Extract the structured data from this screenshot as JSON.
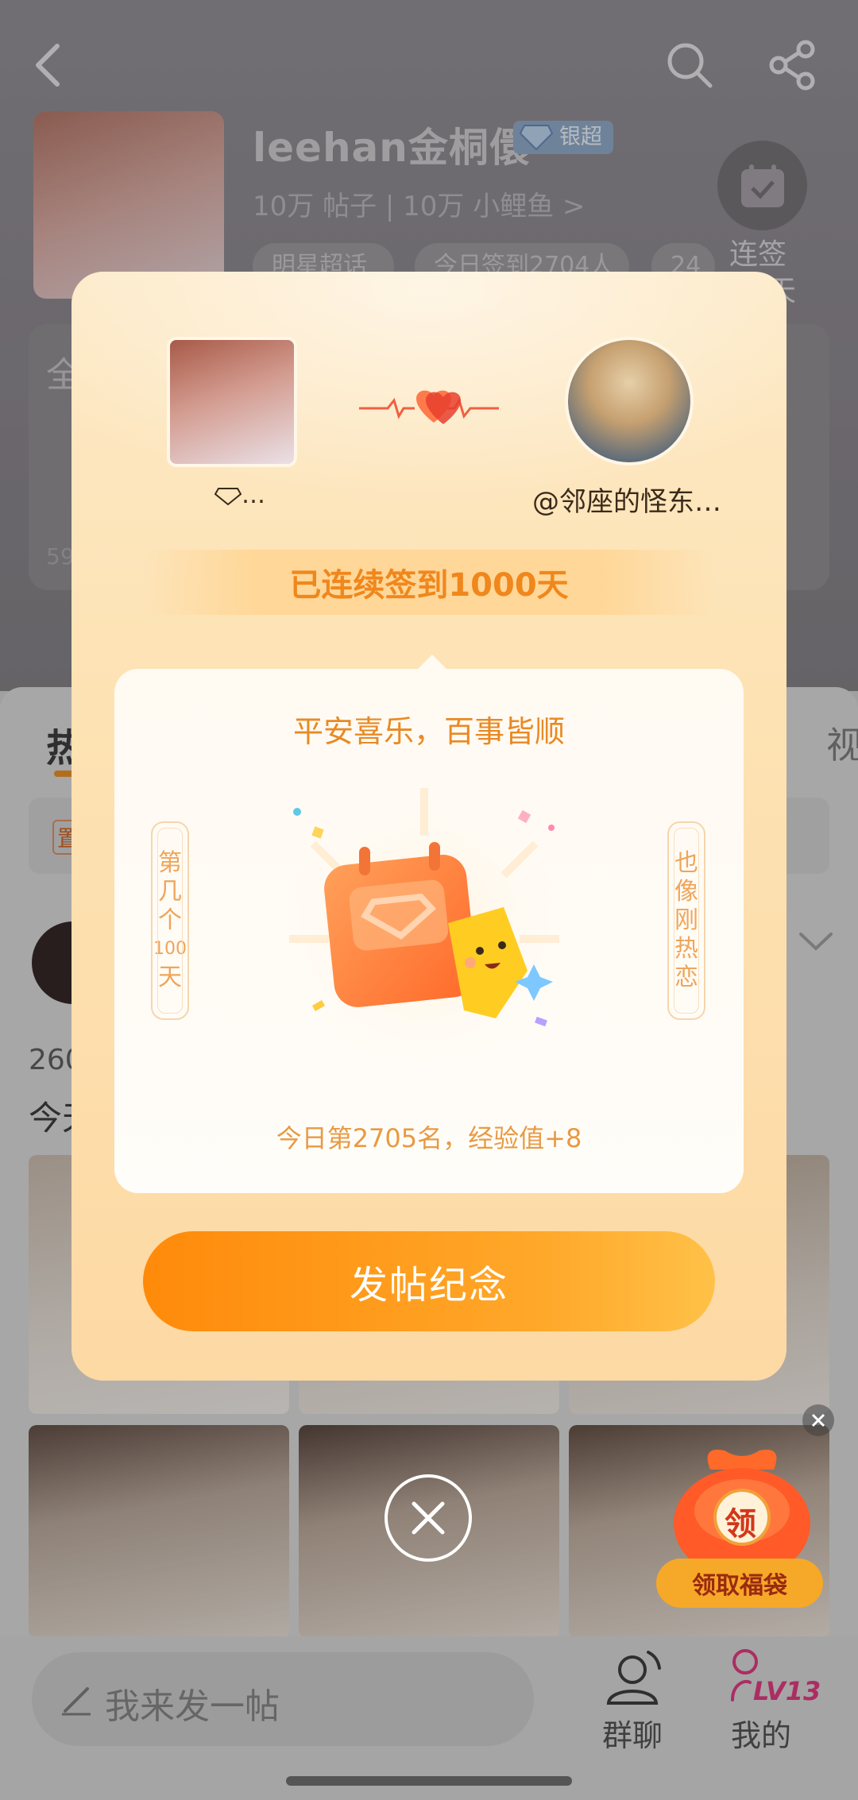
{
  "header": {
    "name": "leehan金桐儇",
    "badge": "银超",
    "stats": "10万 帖子 | 10万 小鲤鱼 >",
    "chips": [
      "明星超话",
      "今日签到2704人",
      "24"
    ],
    "sign_label_line1": "连签",
    "sign_label_line2": "天"
  },
  "background": {
    "card_left_text": "全",
    "count_text": "59",
    "tab_hot": "热",
    "tab_video": "视",
    "pinned": "置",
    "post_count": "260",
    "post_line": "今天"
  },
  "modal": {
    "user_name": "…",
    "partner_name": "@邻座的怪东…",
    "streak_text": "已连续签到1000天",
    "blessing": "平安喜乐，百事皆顺",
    "left_vertical": [
      "第",
      "几",
      "个",
      "100",
      "天"
    ],
    "right_vertical": [
      "也",
      "像",
      "刚",
      "热",
      "恋"
    ],
    "rank_text": "今日第2705名，经验值+8",
    "cta_label": "发帖纪念"
  },
  "lucky_bag": {
    "icon_char": "领",
    "label": "领取福袋"
  },
  "bottom_bar": {
    "post_placeholder": "我来发一帖",
    "group_chat": "群聊",
    "mine": "我的",
    "level": "LV13"
  },
  "colors": {
    "accent_orange": "#f0871c",
    "cta_start": "#ff8a0a",
    "cta_end": "#ffc148",
    "level_pink": "#e0307a"
  }
}
